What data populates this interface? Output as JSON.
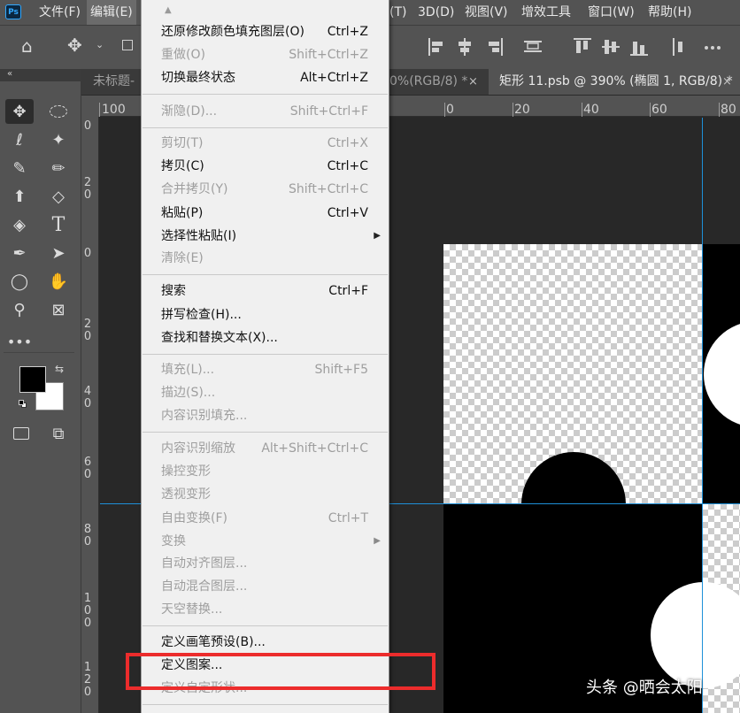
{
  "menubar": {
    "logo": "Ps",
    "items": [
      {
        "label": "文件(F)"
      },
      {
        "label": "编辑(E)"
      },
      {
        "label": "(T)"
      },
      {
        "label": "3D(D)"
      },
      {
        "label": "视图(V)"
      },
      {
        "label": "增效工具"
      },
      {
        "label": "窗口(W)"
      },
      {
        "label": "帮助(H)"
      }
    ]
  },
  "tabs": [
    {
      "label": "未标题-"
    },
    {
      "label": "0%(RGB/8) *",
      "close": "×"
    },
    {
      "label": "矩形 11.psb @ 390% (椭圆 1, RGB/8) *",
      "close": "×"
    }
  ],
  "toolbar": {
    "collapse_glyph": "«"
  },
  "ruler_top": {
    "labels": [
      "100",
      "0",
      "20",
      "40",
      "60",
      "80"
    ]
  },
  "ruler_left": {
    "labels": [
      [
        "0"
      ],
      [
        "2",
        "0"
      ],
      [
        "0"
      ],
      [
        "2",
        "0"
      ],
      [
        "4",
        "0"
      ],
      [
        "6",
        "0"
      ],
      [
        "8",
        "0"
      ],
      [
        "1",
        "0",
        "0"
      ],
      [
        "1",
        "2",
        "0"
      ]
    ]
  },
  "edit_menu": {
    "items": [
      {
        "label": "还原修改颜色填充图层(O)",
        "shortcut": "Ctrl+Z",
        "enabled": true
      },
      {
        "label": "重做(O)",
        "shortcut": "Shift+Ctrl+Z",
        "enabled": false
      },
      {
        "label": "切换最终状态",
        "shortcut": "Alt+Ctrl+Z",
        "enabled": true
      },
      {
        "label": "渐隐(D)...",
        "shortcut": "Shift+Ctrl+F",
        "enabled": false
      },
      {
        "label": "剪切(T)",
        "shortcut": "Ctrl+X",
        "enabled": false
      },
      {
        "label": "拷贝(C)",
        "shortcut": "Ctrl+C",
        "enabled": true
      },
      {
        "label": "合并拷贝(Y)",
        "shortcut": "Shift+Ctrl+C",
        "enabled": false
      },
      {
        "label": "粘贴(P)",
        "shortcut": "Ctrl+V",
        "enabled": true
      },
      {
        "label": "选择性粘贴(I)",
        "shortcut": "",
        "enabled": true,
        "submenu": true
      },
      {
        "label": "清除(E)",
        "shortcut": "",
        "enabled": false
      },
      {
        "label": "搜索",
        "shortcut": "Ctrl+F",
        "enabled": true
      },
      {
        "label": "拼写检查(H)...",
        "shortcut": "",
        "enabled": true
      },
      {
        "label": "查找和替换文本(X)...",
        "shortcut": "",
        "enabled": true
      },
      {
        "label": "填充(L)...",
        "shortcut": "Shift+F5",
        "enabled": false
      },
      {
        "label": "描边(S)...",
        "shortcut": "",
        "enabled": false
      },
      {
        "label": "内容识别填充...",
        "shortcut": "",
        "enabled": false
      },
      {
        "label": "内容识别缩放",
        "shortcut": "Alt+Shift+Ctrl+C",
        "enabled": false
      },
      {
        "label": "操控变形",
        "shortcut": "",
        "enabled": false
      },
      {
        "label": "透视变形",
        "shortcut": "",
        "enabled": false
      },
      {
        "label": "自由变换(F)",
        "shortcut": "Ctrl+T",
        "enabled": false
      },
      {
        "label": "变换",
        "shortcut": "",
        "enabled": false,
        "submenu": true
      },
      {
        "label": "自动对齐图层...",
        "shortcut": "",
        "enabled": false
      },
      {
        "label": "自动混合图层...",
        "shortcut": "",
        "enabled": false
      },
      {
        "label": "天空替换...",
        "shortcut": "",
        "enabled": false
      },
      {
        "label": "定义画笔预设(B)...",
        "shortcut": "",
        "enabled": true
      },
      {
        "label": "定义图案...",
        "shortcut": "",
        "enabled": true
      },
      {
        "label": "定义自定形状...",
        "shortcut": "",
        "enabled": false
      }
    ]
  },
  "watermark": "头条 @晒会太阳",
  "colors": {
    "highlight_border": "#ec2c2c",
    "guide": "#1e90d8",
    "menu_bg": "#f0f0f0"
  }
}
